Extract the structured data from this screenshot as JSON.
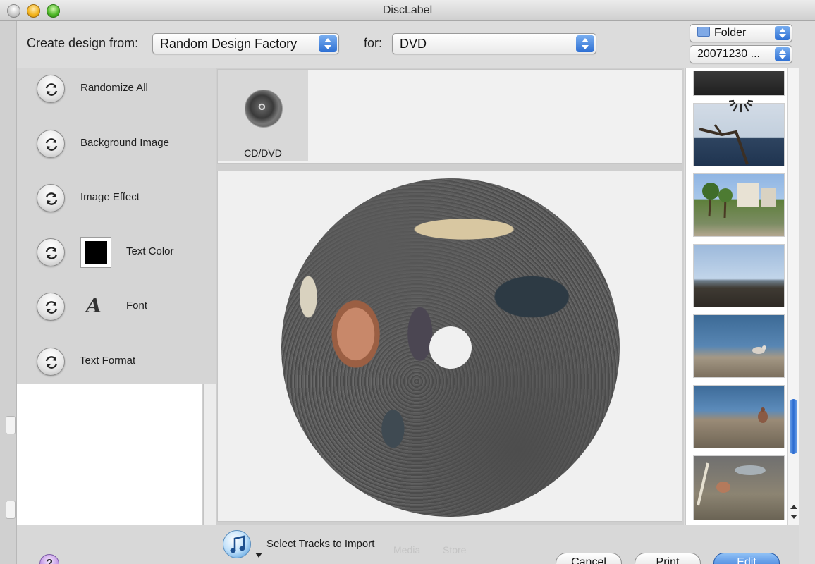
{
  "window": {
    "title": "DiscLabel"
  },
  "toolbar": {
    "create_design_label": "Create design from:",
    "design_source": "Random Design Factory",
    "for_label": "for:",
    "media_type": "DVD",
    "source_type": "Folder",
    "folder_name": "20071230 ..."
  },
  "options": [
    {
      "label": "Randomize All"
    },
    {
      "label": "Background Image"
    },
    {
      "label": "Image Effect"
    },
    {
      "label": "Text Color",
      "color": "#000000"
    },
    {
      "label": "Font"
    },
    {
      "label": "Text Format"
    }
  ],
  "templates": [
    {
      "label": "CD/DVD"
    }
  ],
  "photos": [
    {
      "name": "dark beach rocks",
      "colors": [
        "#2c2c2c",
        "#4a4a4a"
      ]
    },
    {
      "name": "driftwood on shore",
      "colors": [
        "#cfd8e3",
        "#2b3e55"
      ]
    },
    {
      "name": "palm trees and buildings",
      "colors": [
        "#7ea6d8",
        "#5b7d3a"
      ]
    },
    {
      "name": "shoreline at dusk",
      "colors": [
        "#a9c3e0",
        "#403c35"
      ]
    },
    {
      "name": "sea and pebbles",
      "colors": [
        "#3d6f9c",
        "#8f8270"
      ]
    },
    {
      "name": "bird on pebbles",
      "colors": [
        "#4a76a3",
        "#8d7c66"
      ]
    },
    {
      "name": "shells on sand",
      "colors": [
        "#6a6a6a",
        "#8c8470"
      ]
    }
  ],
  "bottom": {
    "itunes_label": "Select Tracks to Import",
    "faded_tab_1": "Media",
    "faded_tab_2": "Store",
    "help": "?",
    "cancel": "Cancel",
    "print": "Print",
    "edit": "Edit"
  },
  "accent_color": "#2d6fd3"
}
